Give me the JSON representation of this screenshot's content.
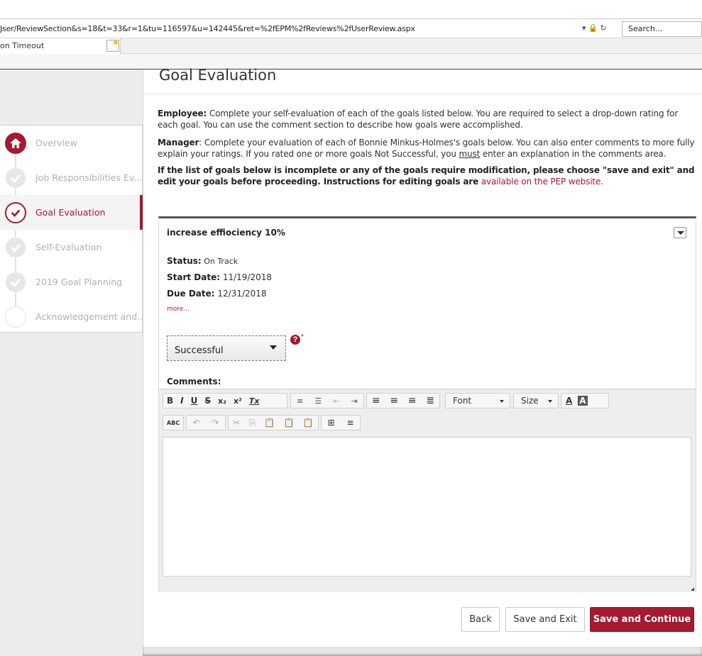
{
  "browser": {
    "url": "Jser/ReviewSection&s=18&t=33&r=1&tu=116597&u=142445&ret=%2fEPM%2fReviews%2fUserReview.aspx",
    "search_placeholder": "Search...",
    "tab_title": "on Timeout",
    "addr_icons": "▾ 🔒 ↻"
  },
  "page": {
    "title": "Goal Evaluation",
    "employee_label": "Employee:",
    "employee_text": " Complete your self-evaluation of each of the goals listed below.  You are required to select a drop-down rating for each goal.  You can use the comment section to describe how goals were accomplished.",
    "manager_label": "Manager",
    "manager_text_1": ": Complete your evaluation of each of Bonnie Minkus-Holmes's goals below.  You can also enter comments to more fully explain your ratings. If you rated one or more goals Not Successful, you ",
    "manager_must": "must",
    "manager_text_2": " enter an explanation in the comments area.",
    "notice_bold": "If the list of goals below is incomplete or any of the goals require modification, please choose \"save and exit\" and edit your goals before proceeding.  Instructions for editing goals are",
    "notice_link": " available on the PEP website",
    "notice_end": "."
  },
  "sidebar": {
    "items": [
      {
        "label": "Overview",
        "icon": "home-icon"
      },
      {
        "label": "Job Responsibilities Ev...",
        "icon": "check-icon"
      },
      {
        "label": "Goal Evaluation",
        "icon": "check-icon"
      },
      {
        "label": "Self-Evaluation",
        "icon": "check-icon"
      },
      {
        "label": "2019 Goal Planning",
        "icon": "check-icon"
      },
      {
        "label": "Acknowledgement and...",
        "icon": "circle-icon"
      }
    ]
  },
  "goal": {
    "name": "increase effiociency 10%",
    "status_label": "Status:",
    "status_value": " On Track",
    "start_label": "Start Date:",
    "start_value": " 11/19/2018",
    "due_label": "Due Date:",
    "due_value": " 12/31/2018",
    "more_link": "more...",
    "rating_value": "Successful",
    "help_glyph": "?",
    "required_mark": "*",
    "comments_label": "Comments:"
  },
  "editor": {
    "bold": "B",
    "italic": "I",
    "underline": "U",
    "strike": "S",
    "subscript": "x₂",
    "superscript": "x²",
    "remove_format": "Tx",
    "font_label": "Font",
    "size_label": "Size",
    "text_color": "A",
    "bg_color": "A",
    "spellcheck": "ABC"
  },
  "buttons": {
    "back": "Back",
    "save_exit": "Save and Exit",
    "save_continue": "Save and Continue"
  },
  "colors": {
    "accent": "#a6192e"
  }
}
